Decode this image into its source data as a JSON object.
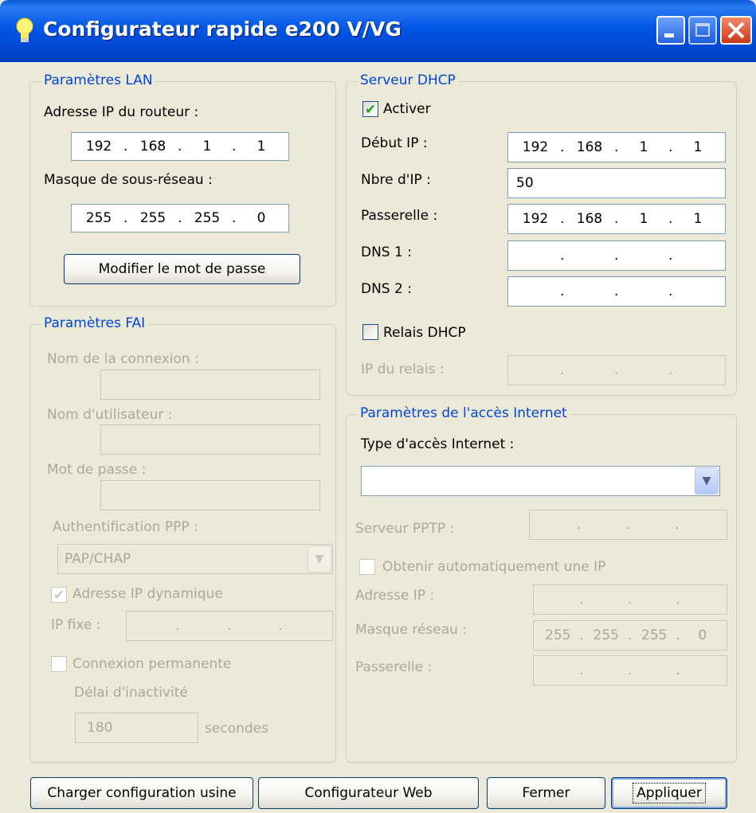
{
  "window": {
    "title": "Configurateur rapide e200 V/VG"
  },
  "lan": {
    "title": "Paramètres LAN",
    "router_ip_label": "Adresse IP du routeur :",
    "router_ip": [
      "192",
      "168",
      "1",
      "1"
    ],
    "subnet_label": "Masque de sous-réseau :",
    "subnet": [
      "255",
      "255",
      "255",
      "0"
    ],
    "change_password_button": "Modifier le mot de passe"
  },
  "fai": {
    "title": "Paramètres FAI",
    "connection_name_label": "Nom de la connexion :",
    "username_label": "Nom d'utilisateur :",
    "password_label": "Mot de passe :",
    "auth_label": "Authentification PPP :",
    "auth_value": "PAP/CHAP",
    "dynamic_ip_label": "Adresse IP dynamique",
    "dynamic_ip_checked": true,
    "fixed_ip_label": "IP fixe :",
    "permanent_label": "Connexion permanente",
    "permanent_checked": false,
    "idle_label": "Délai d'inactivité",
    "idle_value": "180",
    "idle_unit": "secondes"
  },
  "dhcp": {
    "title": "Serveur DHCP",
    "enable_label": "Activer",
    "enable_checked": true,
    "start_ip_label": "Début IP :",
    "start_ip": [
      "192",
      "168",
      "1",
      "1"
    ],
    "count_label": "Nbre d'IP :",
    "count_value": "50",
    "gateway_label": "Passerelle :",
    "gateway_ip": [
      "192",
      "168",
      "1",
      "1"
    ],
    "dns1_label": "DNS 1 :",
    "dns2_label": "DNS 2 :",
    "relay_label": "Relais DHCP",
    "relay_checked": false,
    "relay_ip_label": "IP du relais :"
  },
  "internet": {
    "title": "Paramètres de l'accès Internet",
    "type_label": "Type d'accès Internet :",
    "type_value": "",
    "pptp_server_label": "Serveur PPTP :",
    "auto_ip_label": "Obtenir automatiquement une IP",
    "auto_ip_checked": false,
    "ip_label": "Adresse IP :",
    "mask_label": "Masque réseau :",
    "mask": [
      "255",
      "255",
      "255",
      "0"
    ],
    "gateway_label": "Passerelle :"
  },
  "buttons": {
    "factory": "Charger configuration usine",
    "web": "Configurateur Web",
    "close": "Fermer",
    "apply": "Appliquer"
  },
  "icons": {
    "title": "lightbulb-icon",
    "minimize": "minimize-icon",
    "maximize": "maximize-icon",
    "close": "close-icon",
    "dropdown": "chevron-down-icon",
    "check": "checkmark-icon"
  },
  "colors": {
    "titlebar": "#0055e5",
    "group_label": "#0046d5",
    "window_bg": "#ece9d8",
    "close_button": "#d5431f",
    "check_green": "#21a121"
  }
}
